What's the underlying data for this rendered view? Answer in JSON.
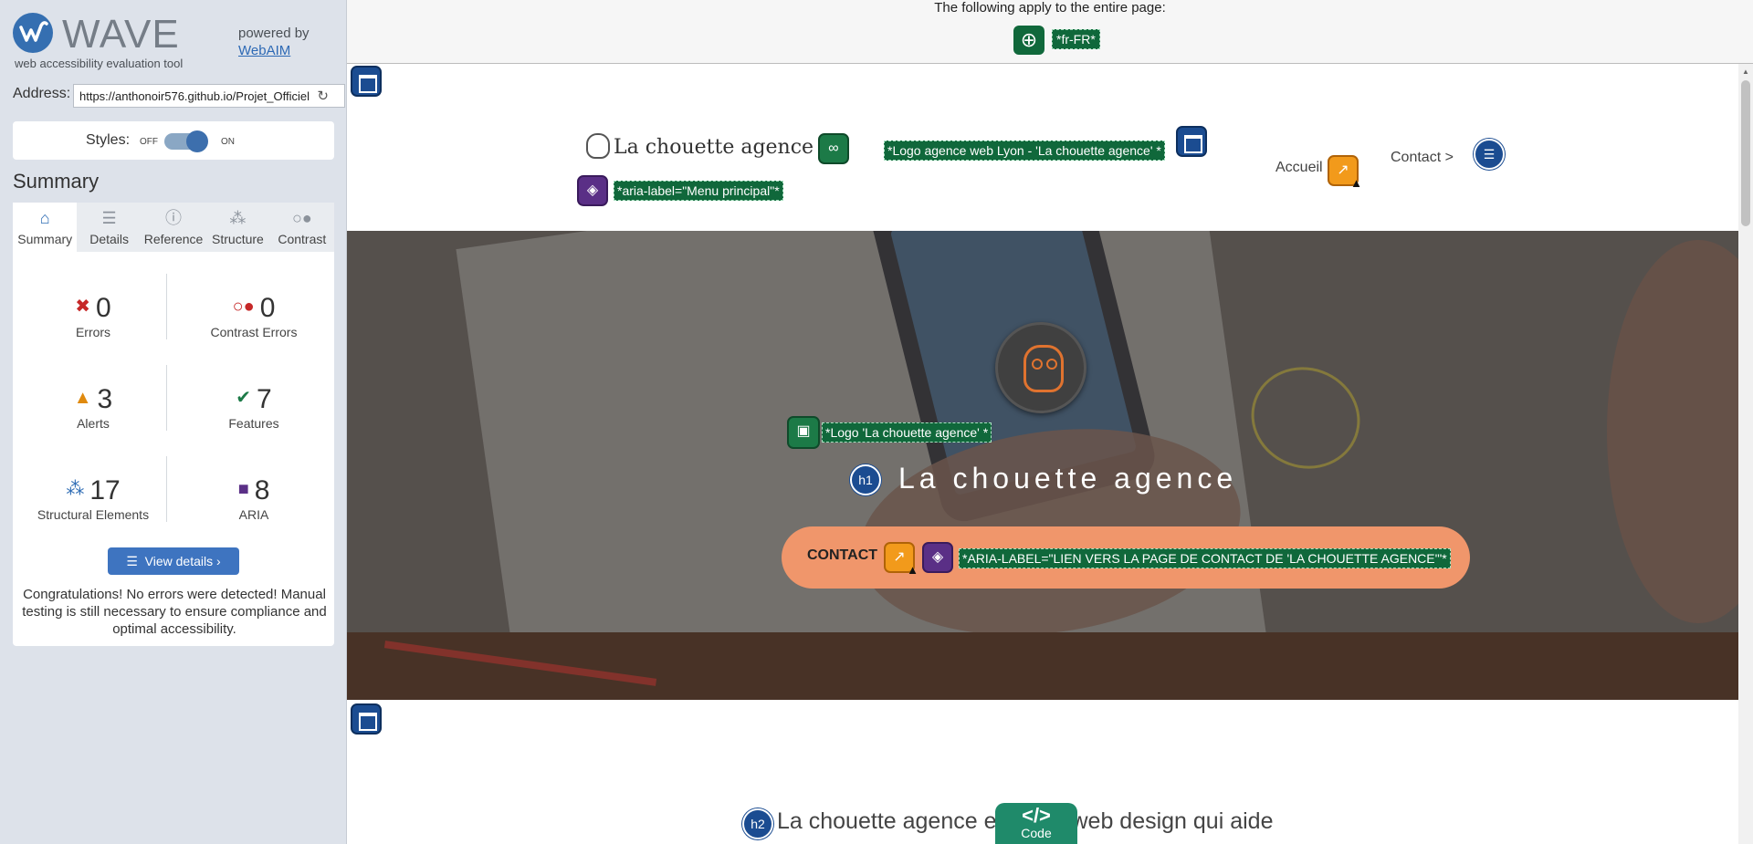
{
  "sidebar": {
    "app_name": "WAVE",
    "tagline": "web accessibility evaluation tool",
    "powered_by": "powered by",
    "webaim_link": "WebAIM",
    "address_label": "Address:",
    "address_value": "https://anthonoir576.github.io/Projet_Officiel",
    "styles_label": "Styles:",
    "styles_off": "OFF",
    "styles_on": "ON",
    "summary_heading": "Summary",
    "tabs": [
      {
        "label": "Summary",
        "icon": "home-icon"
      },
      {
        "label": "Details",
        "icon": "list-icon"
      },
      {
        "label": "Reference",
        "icon": "info-icon"
      },
      {
        "label": "Structure",
        "icon": "structure-icon"
      },
      {
        "label": "Contrast",
        "icon": "contrast-icon"
      }
    ],
    "stats": {
      "errors": {
        "value": "0",
        "label": "Errors"
      },
      "contrast_errors": {
        "value": "0",
        "label": "Contrast Errors"
      },
      "alerts": {
        "value": "3",
        "label": "Alerts"
      },
      "features": {
        "value": "7",
        "label": "Features"
      },
      "structural": {
        "value": "17",
        "label": "Structural Elements"
      },
      "aria": {
        "value": "8",
        "label": "ARIA"
      }
    },
    "view_details": "View details ›",
    "congrats": "Congratulations! No errors were detected! Manual testing is still necessary to ensure compliance and optimal accessibility."
  },
  "banner": {
    "text": "The following apply to the entire page:",
    "lang_label": "*fr-FR*"
  },
  "page": {
    "logo_text": "La chouette agence",
    "logo_alt_label": "*Logo agence web Lyon - 'La chouette agence' *",
    "menu_aria_label": "*aria-label=\"Menu principal\"*",
    "nav_home": "Accueil",
    "nav_contact": "Contact >",
    "hero_logo_alt": "*Logo 'La chouette agence' *",
    "h1_badge": "h1",
    "hero_title": "La chouette agence",
    "cta_text": "CONTACT",
    "cta_aria_label": "*ARIA-LABEL=\"LIEN VERS LA PAGE DE CONTACT DE 'LA CHOUETTE AGENCE'\"*",
    "h2_badge": "h2",
    "section_title": "La chouette agence e     gence web design qui aide",
    "code_glyph": "</>",
    "code_label": "Code"
  },
  "colors": {
    "wave_blue": "#356fb1",
    "feature_green": "#10683b",
    "aria_purple": "#5a2f86",
    "alert_orange": "#f29a1b",
    "cta_orange": "#f0966b"
  }
}
